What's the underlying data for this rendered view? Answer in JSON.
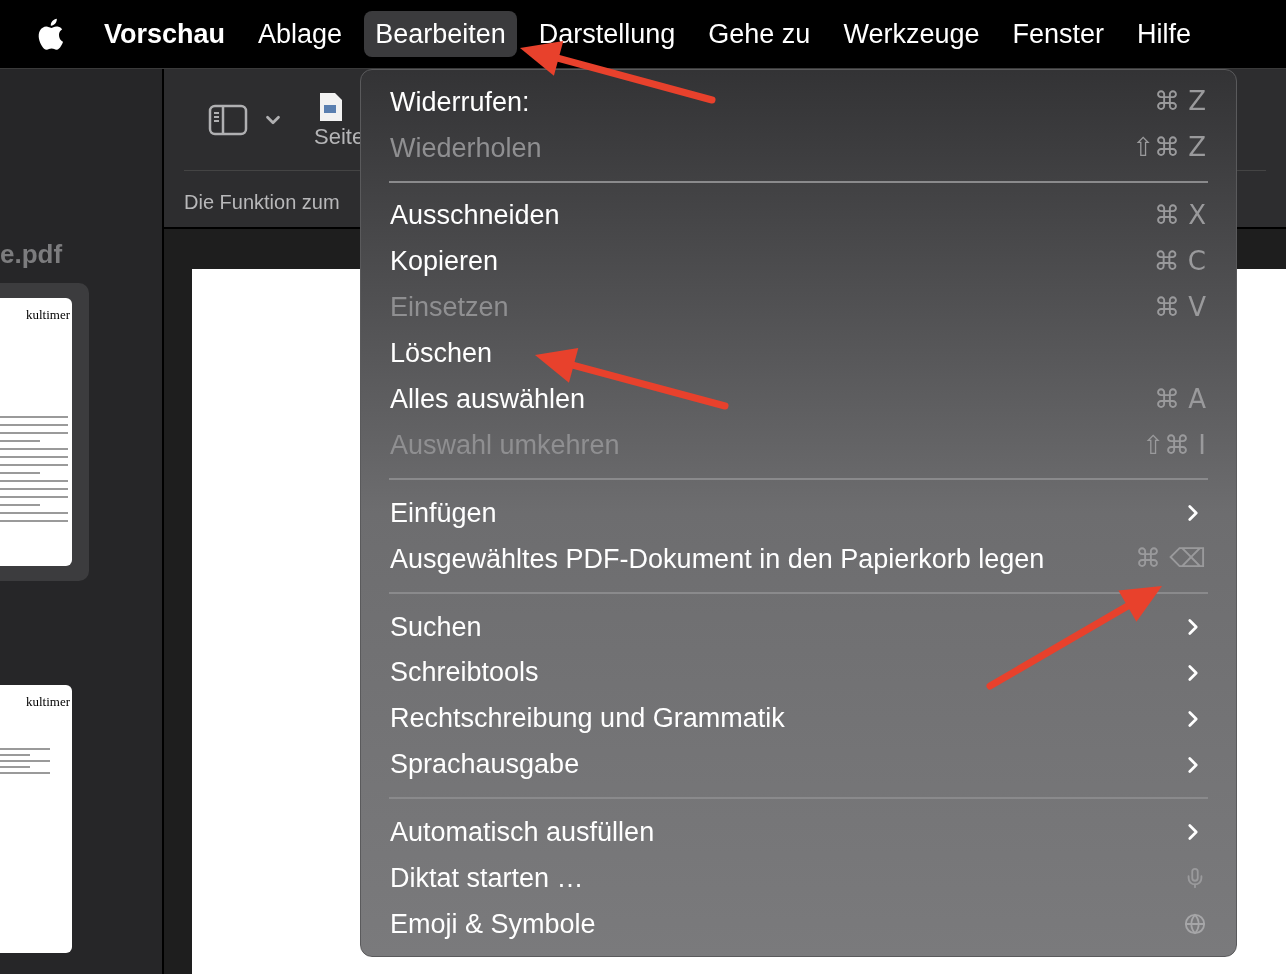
{
  "menu_bar": {
    "items": [
      {
        "label": "Vorschau",
        "kind": "app",
        "selected": false
      },
      {
        "label": "Ablage",
        "kind": "menu",
        "selected": false
      },
      {
        "label": "Bearbeiten",
        "kind": "menu",
        "selected": true
      },
      {
        "label": "Darstellung",
        "kind": "menu",
        "selected": false
      },
      {
        "label": "Gehe zu",
        "kind": "menu",
        "selected": false
      },
      {
        "label": "Werkzeuge",
        "kind": "menu",
        "selected": false
      },
      {
        "label": "Fenster",
        "kind": "menu",
        "selected": false
      },
      {
        "label": "Hilfe",
        "kind": "menu",
        "selected": false
      }
    ]
  },
  "sidebar": {
    "file_name": "e.pdf",
    "thumbnails": [
      {
        "header": "kultimer",
        "selected": true
      },
      {
        "header": "kultimer",
        "selected": false
      }
    ]
  },
  "toolbar": {
    "page_button": "Seite",
    "info_text": "Die Funktion zum"
  },
  "edit_menu": {
    "sections": [
      [
        {
          "kind": "shortcut",
          "label": "Widerrufen:",
          "disabled": false,
          "shortcut": "⌘ Z"
        },
        {
          "kind": "shortcut",
          "label": "Wiederholen",
          "disabled": true,
          "shortcut": "⇧⌘ Z"
        }
      ],
      [
        {
          "kind": "shortcut",
          "label": "Ausschneiden",
          "disabled": false,
          "shortcut": "⌘ X"
        },
        {
          "kind": "shortcut",
          "label": "Kopieren",
          "disabled": false,
          "shortcut": "⌘ C"
        },
        {
          "kind": "shortcut",
          "label": "Einsetzen",
          "disabled": true,
          "shortcut": "⌘ V"
        },
        {
          "kind": "plain",
          "label": "Löschen",
          "disabled": false
        },
        {
          "kind": "shortcut",
          "label": "Alles auswählen",
          "disabled": false,
          "shortcut": "⌘ A"
        },
        {
          "kind": "shortcut",
          "label": "Auswahl umkehren",
          "disabled": true,
          "shortcut": "⇧⌘ I"
        }
      ],
      [
        {
          "kind": "submenu",
          "label": "Einfügen",
          "disabled": false
        },
        {
          "kind": "shortcut",
          "label": "Ausgewähltes PDF-Dokument in den Papierkorb legen",
          "disabled": false,
          "shortcut": "⌘ ⌫"
        }
      ],
      [
        {
          "kind": "submenu",
          "label": "Suchen",
          "disabled": false
        },
        {
          "kind": "submenu",
          "label": "Schreibtools",
          "disabled": false
        },
        {
          "kind": "submenu",
          "label": "Rechtschreibung und Grammatik",
          "disabled": false
        },
        {
          "kind": "submenu",
          "label": "Sprachausgabe",
          "disabled": false
        }
      ],
      [
        {
          "kind": "submenu",
          "label": "Automatisch ausfüllen",
          "disabled": false
        },
        {
          "kind": "dictation",
          "label": "Diktat starten …",
          "disabled": false
        },
        {
          "kind": "emoji",
          "label": "Emoji & Symbole",
          "disabled": false
        }
      ]
    ]
  }
}
